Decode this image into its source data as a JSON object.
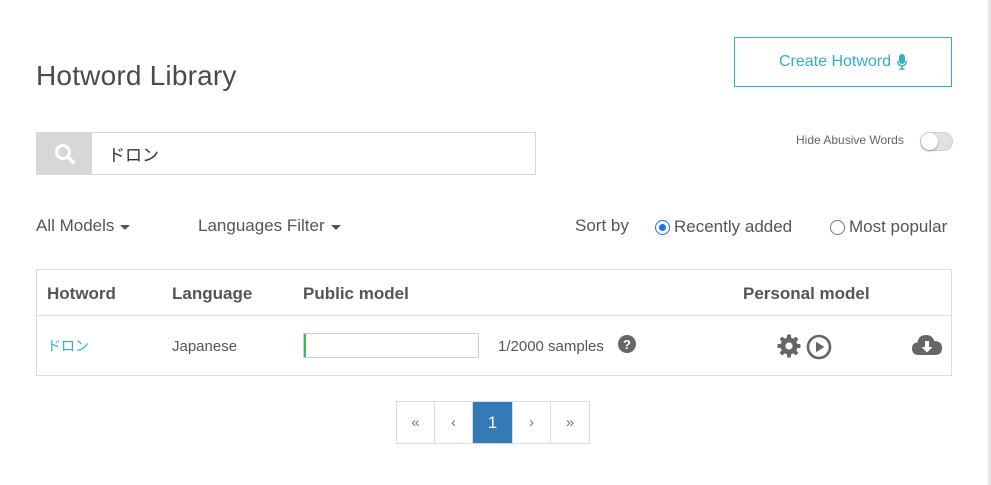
{
  "page_title": "Hotword Library",
  "create_button": {
    "label": "Create Hotword",
    "icon": "microphone-icon"
  },
  "search": {
    "value": "ドロン",
    "placeholder": "",
    "icon": "search-icon"
  },
  "hide_abusive": {
    "label": "Hide Abusive Words",
    "enabled": false
  },
  "filters": {
    "models": "All Models",
    "languages": "Languages Filter"
  },
  "sort": {
    "label": "Sort by",
    "options": [
      {
        "label": "Recently added",
        "selected": true
      },
      {
        "label": "Most popular",
        "selected": false
      }
    ]
  },
  "table": {
    "headers": {
      "hotword": "Hotword",
      "language": "Language",
      "public_model": "Public model",
      "personal_model": "Personal model"
    },
    "rows": [
      {
        "hotword": "ドロン",
        "language": "Japanese",
        "samples_text": "1/2000 samples",
        "progress_fraction": 0.0005,
        "help_icon": "question-circle-icon",
        "personal_icons": [
          "gear-icon",
          "play-circle-icon"
        ],
        "download_icon": "cloud-download-icon"
      }
    ]
  },
  "pagination": {
    "first": "«",
    "prev": "‹",
    "current": "1",
    "next": "›",
    "last": "»"
  },
  "colors": {
    "accent": "#2fb0c8",
    "active_page": "#337ab7",
    "progress": "#3cba54",
    "radio_selected": "#1a73e8"
  }
}
